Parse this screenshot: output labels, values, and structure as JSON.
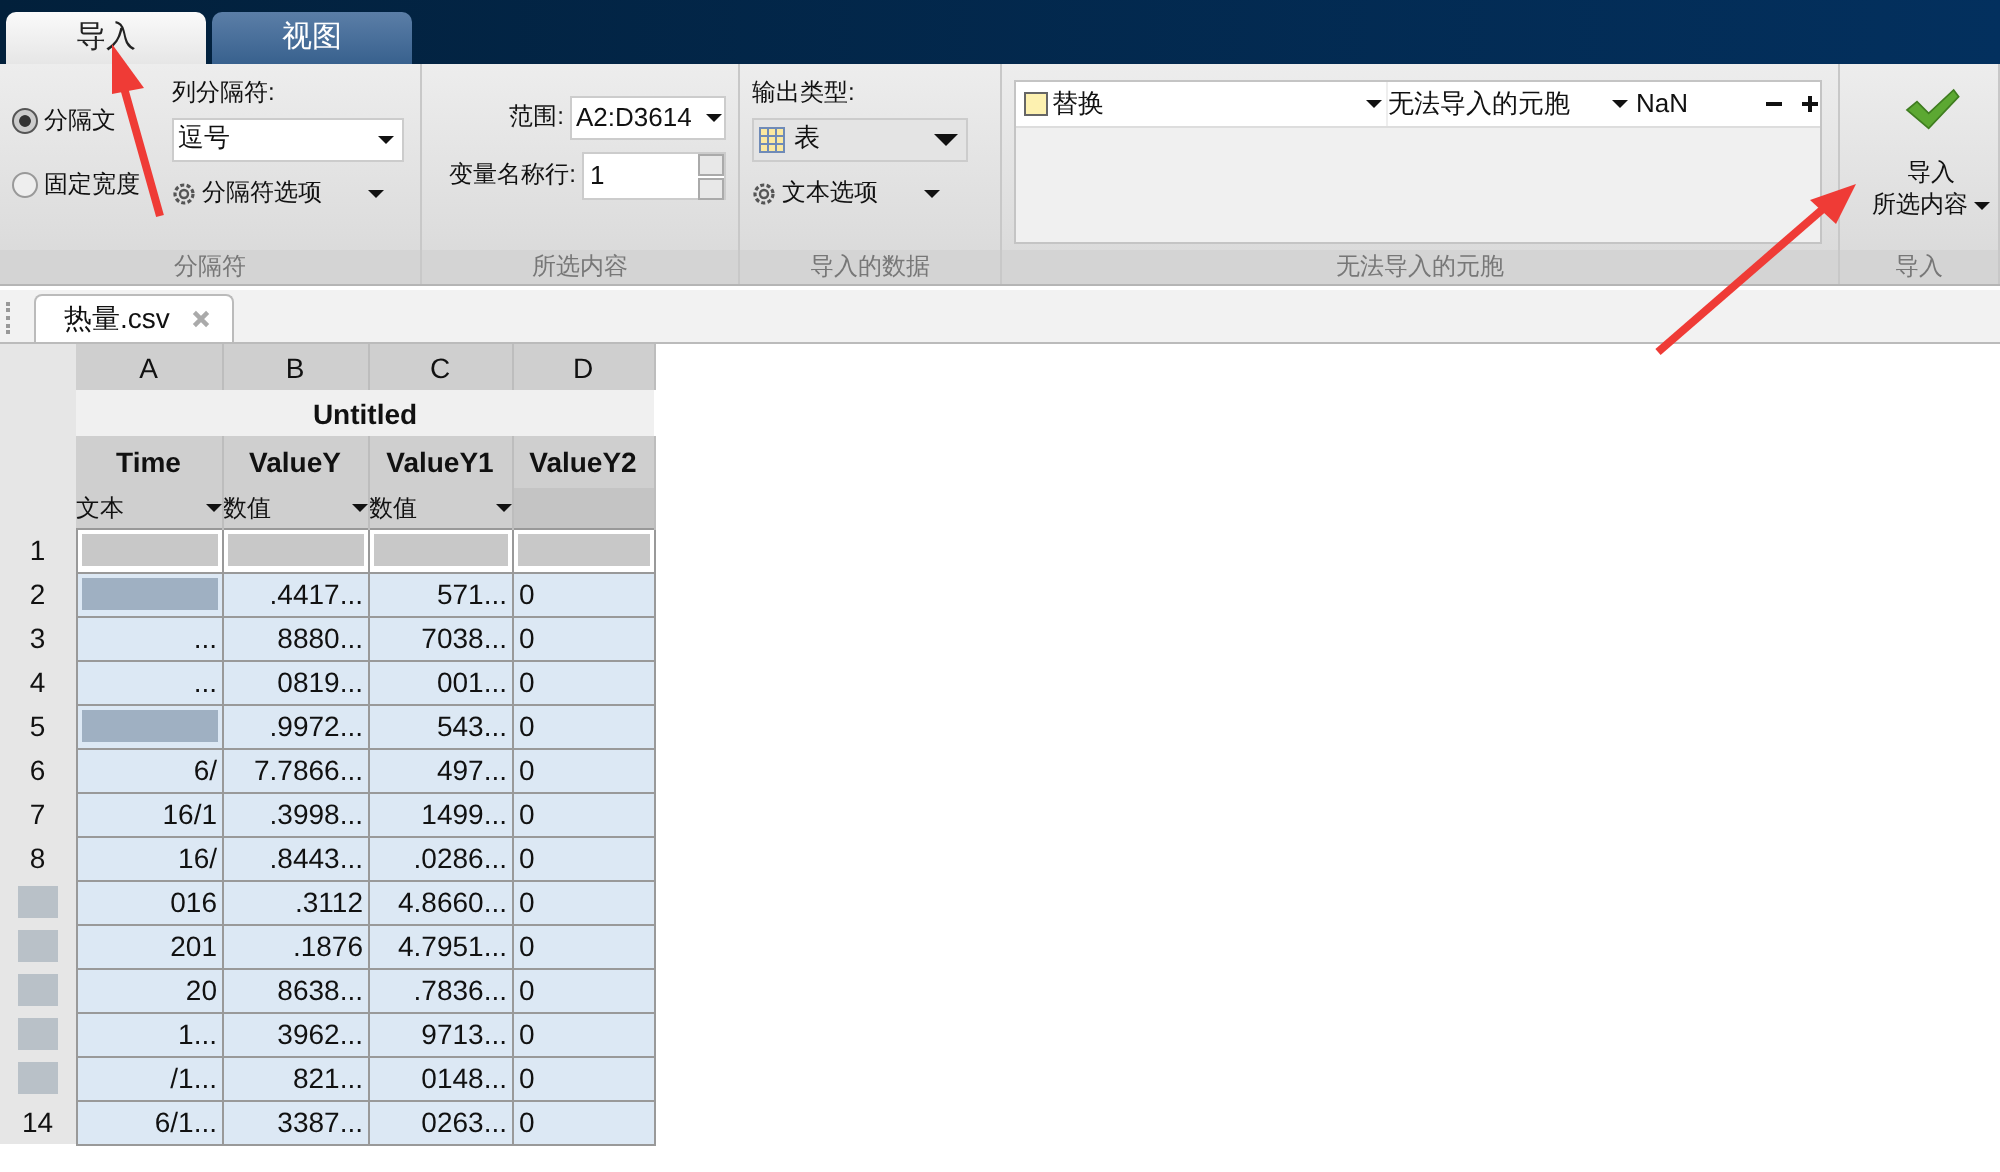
{
  "tabs": [
    {
      "label": "导入",
      "selected": true
    },
    {
      "label": "视图",
      "selected": false
    }
  ],
  "delimiter_group": {
    "radios": [
      {
        "label": "分隔文",
        "selected": true
      },
      {
        "label": "固定宽度",
        "selected": false
      }
    ],
    "column_delimiter_label": "列分隔符:",
    "column_delimiter": "逗号",
    "options_button": "分隔符选项",
    "title": "分隔符"
  },
  "selection_group": {
    "range_label": "范围:",
    "range": "A2:D3614",
    "varname_row_label": "变量名称行:",
    "varname_row": "1",
    "title": "所选内容"
  },
  "imported_data_group": {
    "output_type_label": "输出类型:",
    "output_type": "表",
    "options_button": "文本选项",
    "title": "导入的数据"
  },
  "unimportable_group": {
    "rules": [
      {
        "checked": false,
        "action": "替换",
        "condition": "无法导入的元胞",
        "value": "NaN"
      }
    ],
    "title": "无法导入的元胞"
  },
  "import_group": {
    "button_line1": "导入",
    "button_line2": "所选内容",
    "title": "导入"
  },
  "document_tab": {
    "label": "热量.csv"
  },
  "table": {
    "group_title": "Untitled",
    "columns": [
      {
        "letter": "A",
        "name": "Time",
        "type": "文本"
      },
      {
        "letter": "B",
        "name": "ValueY",
        "type": "数值"
      },
      {
        "letter": "C",
        "name": "ValueY1",
        "type": "数值"
      },
      {
        "letter": "D",
        "name": "ValueY2"
      }
    ],
    "rows": [
      {
        "label": "1",
        "selected": false,
        "cells": [
          null,
          null,
          null,
          null
        ]
      },
      {
        "label": "2",
        "selected": true,
        "cells": [
          null,
          ".4417...",
          "571...",
          "0"
        ]
      },
      {
        "label": "3",
        "selected": true,
        "cells": [
          "...",
          "8880...",
          "7038...",
          "0"
        ]
      },
      {
        "label": "4",
        "selected": true,
        "cells": [
          "...",
          "0819...",
          "001...",
          "0"
        ]
      },
      {
        "label": "5",
        "selected": true,
        "cells": [
          null,
          ".9972...",
          "543...",
          "0"
        ]
      },
      {
        "label": "6",
        "selected": true,
        "cells": [
          "6/",
          "7.7866...",
          "497...",
          "0"
        ]
      },
      {
        "label": "7",
        "selected": true,
        "cells": [
          "16/1",
          ".3998...",
          "1499...",
          "0"
        ]
      },
      {
        "label": "8",
        "selected": true,
        "cells": [
          "16/",
          ".8443...",
          ".0286...",
          "0"
        ]
      },
      {
        "selected": true,
        "cells": [
          "016",
          ".3112",
          "4.8660...",
          "0"
        ]
      },
      {
        "selected": true,
        "cells": [
          "201",
          ".1876",
          "4.7951...",
          "0"
        ]
      },
      {
        "selected": true,
        "cells": [
          "20",
          "8638...",
          ".7836...",
          "0"
        ]
      },
      {
        "selected": true,
        "cells": [
          "1...",
          "3962...",
          "9713...",
          "0"
        ]
      },
      {
        "selected": true,
        "cells": [
          "/1...",
          "821...",
          "0148...",
          "0"
        ]
      },
      {
        "label": "14",
        "selected": true,
        "cells": [
          "6/1...",
          "3387...",
          "0263...",
          "0"
        ]
      }
    ]
  }
}
